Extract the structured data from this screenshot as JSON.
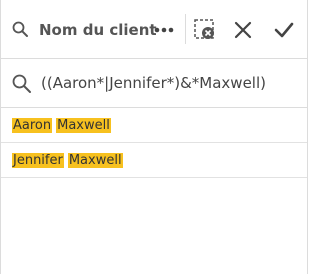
{
  "header": {
    "title": "Nom du client",
    "icons": {
      "field": "search-icon",
      "more": "more-options-icon",
      "clear": "clear-selections-icon",
      "cancel": "close-icon",
      "confirm": "checkmark-icon"
    }
  },
  "search": {
    "value": "((Aaron*|Jennifer*)&*Maxwell)",
    "icon": "search-icon"
  },
  "results": [
    {
      "first": "Aaron",
      "last": "Maxwell"
    },
    {
      "first": "Jennifer",
      "last": "Maxwell"
    }
  ],
  "colors": {
    "highlight": "#f7c11f",
    "border": "#dcdcdc",
    "text": "#404040"
  }
}
